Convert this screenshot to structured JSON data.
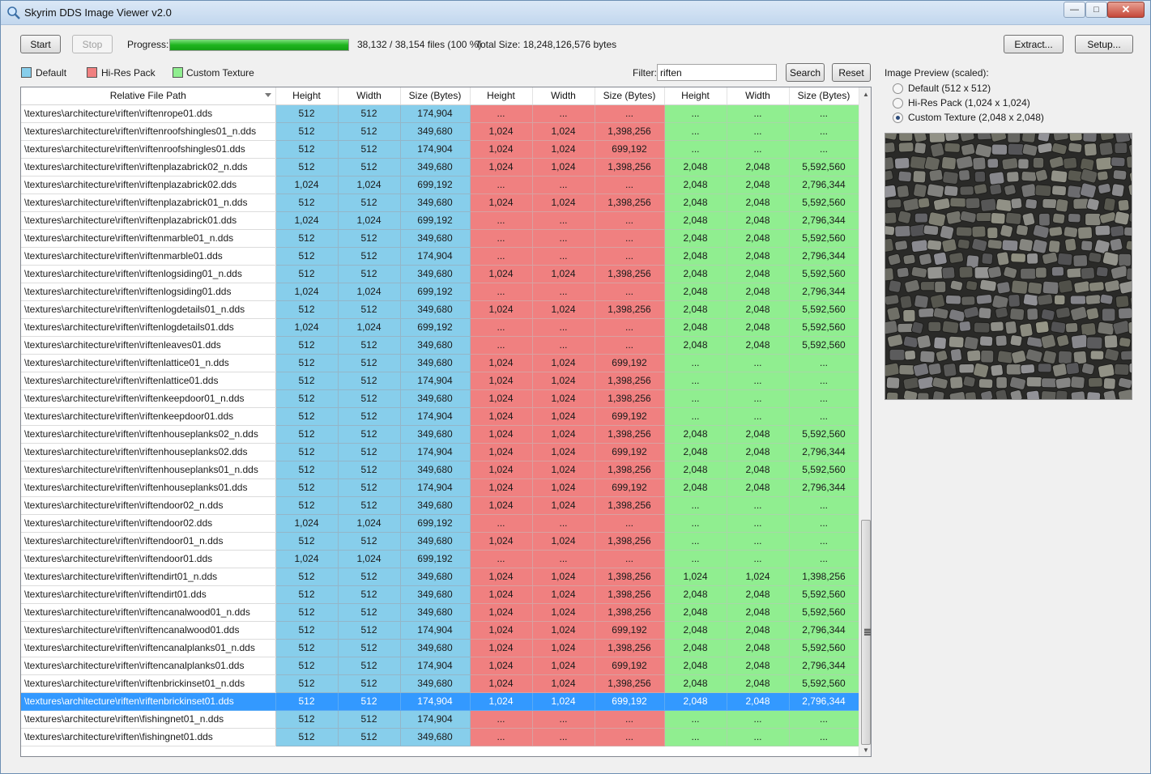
{
  "window": {
    "title": "Skyrim DDS Image Viewer v2.0",
    "min": "—",
    "max": "□",
    "close": "✕"
  },
  "toolbar": {
    "start": "Start",
    "stop": "Stop",
    "progress_label": "Progress:",
    "progress_fraction": 1.0,
    "files_text": "38,132 / 38,154 files (100 %)",
    "total_size": "Total Size: 18,248,126,576 bytes",
    "extract": "Extract...",
    "setup": "Setup..."
  },
  "legend": {
    "default": "Default",
    "hires": "Hi-Res Pack",
    "custom": "Custom Texture"
  },
  "colors": {
    "default": "#87ceeb",
    "hires": "#f08080",
    "custom": "#90ee90",
    "selected": "#3399ff"
  },
  "filter": {
    "label": "Filter:",
    "value": "riften",
    "search": "Search",
    "reset": "Reset"
  },
  "preview": {
    "label": "Image Preview (scaled):",
    "options": [
      "Default (512 x 512)",
      "Hi-Res Pack (1,024 x 1,024)",
      "Custom Texture (2,048 x 2,048)"
    ],
    "selected_index": 2
  },
  "grid": {
    "columns": [
      "Relative File Path",
      "Height",
      "Width",
      "Size (Bytes)",
      "Height",
      "Width",
      "Size (Bytes)",
      "Height",
      "Width",
      "Size (Bytes)"
    ],
    "selected_row": 33,
    "rows": [
      [
        "\\textures\\architecture\\riften\\riftenrope01.dds",
        "512",
        "512",
        "174,904",
        "...",
        "...",
        "...",
        "...",
        "...",
        "..."
      ],
      [
        "\\textures\\architecture\\riften\\riftenroofshingles01_n.dds",
        "512",
        "512",
        "349,680",
        "1,024",
        "1,024",
        "1,398,256",
        "...",
        "...",
        "..."
      ],
      [
        "\\textures\\architecture\\riften\\riftenroofshingles01.dds",
        "512",
        "512",
        "174,904",
        "1,024",
        "1,024",
        "699,192",
        "...",
        "...",
        "..."
      ],
      [
        "\\textures\\architecture\\riften\\riftenplazabrick02_n.dds",
        "512",
        "512",
        "349,680",
        "1,024",
        "1,024",
        "1,398,256",
        "2,048",
        "2,048",
        "5,592,560"
      ],
      [
        "\\textures\\architecture\\riften\\riftenplazabrick02.dds",
        "1,024",
        "1,024",
        "699,192",
        "...",
        "...",
        "...",
        "2,048",
        "2,048",
        "2,796,344"
      ],
      [
        "\\textures\\architecture\\riften\\riftenplazabrick01_n.dds",
        "512",
        "512",
        "349,680",
        "1,024",
        "1,024",
        "1,398,256",
        "2,048",
        "2,048",
        "5,592,560"
      ],
      [
        "\\textures\\architecture\\riften\\riftenplazabrick01.dds",
        "1,024",
        "1,024",
        "699,192",
        "...",
        "...",
        "...",
        "2,048",
        "2,048",
        "2,796,344"
      ],
      [
        "\\textures\\architecture\\riften\\riftenmarble01_n.dds",
        "512",
        "512",
        "349,680",
        "...",
        "...",
        "...",
        "2,048",
        "2,048",
        "5,592,560"
      ],
      [
        "\\textures\\architecture\\riften\\riftenmarble01.dds",
        "512",
        "512",
        "174,904",
        "...",
        "...",
        "...",
        "2,048",
        "2,048",
        "2,796,344"
      ],
      [
        "\\textures\\architecture\\riften\\riftenlogsiding01_n.dds",
        "512",
        "512",
        "349,680",
        "1,024",
        "1,024",
        "1,398,256",
        "2,048",
        "2,048",
        "5,592,560"
      ],
      [
        "\\textures\\architecture\\riften\\riftenlogsiding01.dds",
        "1,024",
        "1,024",
        "699,192",
        "...",
        "...",
        "...",
        "2,048",
        "2,048",
        "2,796,344"
      ],
      [
        "\\textures\\architecture\\riften\\riftenlogdetails01_n.dds",
        "512",
        "512",
        "349,680",
        "1,024",
        "1,024",
        "1,398,256",
        "2,048",
        "2,048",
        "5,592,560"
      ],
      [
        "\\textures\\architecture\\riften\\riftenlogdetails01.dds",
        "1,024",
        "1,024",
        "699,192",
        "...",
        "...",
        "...",
        "2,048",
        "2,048",
        "5,592,560"
      ],
      [
        "\\textures\\architecture\\riften\\riftenleaves01.dds",
        "512",
        "512",
        "349,680",
        "...",
        "...",
        "...",
        "2,048",
        "2,048",
        "5,592,560"
      ],
      [
        "\\textures\\architecture\\riften\\riftenlattice01_n.dds",
        "512",
        "512",
        "349,680",
        "1,024",
        "1,024",
        "699,192",
        "...",
        "...",
        "..."
      ],
      [
        "\\textures\\architecture\\riften\\riftenlattice01.dds",
        "512",
        "512",
        "174,904",
        "1,024",
        "1,024",
        "1,398,256",
        "...",
        "...",
        "..."
      ],
      [
        "\\textures\\architecture\\riften\\riftenkeepdoor01_n.dds",
        "512",
        "512",
        "349,680",
        "1,024",
        "1,024",
        "1,398,256",
        "...",
        "...",
        "..."
      ],
      [
        "\\textures\\architecture\\riften\\riftenkeepdoor01.dds",
        "512",
        "512",
        "174,904",
        "1,024",
        "1,024",
        "699,192",
        "...",
        "...",
        "..."
      ],
      [
        "\\textures\\architecture\\riften\\riftenhouseplanks02_n.dds",
        "512",
        "512",
        "349,680",
        "1,024",
        "1,024",
        "1,398,256",
        "2,048",
        "2,048",
        "5,592,560"
      ],
      [
        "\\textures\\architecture\\riften\\riftenhouseplanks02.dds",
        "512",
        "512",
        "174,904",
        "1,024",
        "1,024",
        "699,192",
        "2,048",
        "2,048",
        "2,796,344"
      ],
      [
        "\\textures\\architecture\\riften\\riftenhouseplanks01_n.dds",
        "512",
        "512",
        "349,680",
        "1,024",
        "1,024",
        "1,398,256",
        "2,048",
        "2,048",
        "5,592,560"
      ],
      [
        "\\textures\\architecture\\riften\\riftenhouseplanks01.dds",
        "512",
        "512",
        "174,904",
        "1,024",
        "1,024",
        "699,192",
        "2,048",
        "2,048",
        "2,796,344"
      ],
      [
        "\\textures\\architecture\\riften\\riftendoor02_n.dds",
        "512",
        "512",
        "349,680",
        "1,024",
        "1,024",
        "1,398,256",
        "...",
        "...",
        "..."
      ],
      [
        "\\textures\\architecture\\riften\\riftendoor02.dds",
        "1,024",
        "1,024",
        "699,192",
        "...",
        "...",
        "...",
        "...",
        "...",
        "..."
      ],
      [
        "\\textures\\architecture\\riften\\riftendoor01_n.dds",
        "512",
        "512",
        "349,680",
        "1,024",
        "1,024",
        "1,398,256",
        "...",
        "...",
        "..."
      ],
      [
        "\\textures\\architecture\\riften\\riftendoor01.dds",
        "1,024",
        "1,024",
        "699,192",
        "...",
        "...",
        "...",
        "...",
        "...",
        "..."
      ],
      [
        "\\textures\\architecture\\riften\\riftendirt01_n.dds",
        "512",
        "512",
        "349,680",
        "1,024",
        "1,024",
        "1,398,256",
        "1,024",
        "1,024",
        "1,398,256"
      ],
      [
        "\\textures\\architecture\\riften\\riftendirt01.dds",
        "512",
        "512",
        "349,680",
        "1,024",
        "1,024",
        "1,398,256",
        "2,048",
        "2,048",
        "5,592,560"
      ],
      [
        "\\textures\\architecture\\riften\\riftencanalwood01_n.dds",
        "512",
        "512",
        "349,680",
        "1,024",
        "1,024",
        "1,398,256",
        "2,048",
        "2,048",
        "5,592,560"
      ],
      [
        "\\textures\\architecture\\riften\\riftencanalwood01.dds",
        "512",
        "512",
        "174,904",
        "1,024",
        "1,024",
        "699,192",
        "2,048",
        "2,048",
        "2,796,344"
      ],
      [
        "\\textures\\architecture\\riften\\riftencanalplanks01_n.dds",
        "512",
        "512",
        "349,680",
        "1,024",
        "1,024",
        "1,398,256",
        "2,048",
        "2,048",
        "5,592,560"
      ],
      [
        "\\textures\\architecture\\riften\\riftencanalplanks01.dds",
        "512",
        "512",
        "174,904",
        "1,024",
        "1,024",
        "699,192",
        "2,048",
        "2,048",
        "2,796,344"
      ],
      [
        "\\textures\\architecture\\riften\\riftenbrickinset01_n.dds",
        "512",
        "512",
        "349,680",
        "1,024",
        "1,024",
        "1,398,256",
        "2,048",
        "2,048",
        "5,592,560"
      ],
      [
        "\\textures\\architecture\\riften\\riftenbrickinset01.dds",
        "512",
        "512",
        "174,904",
        "1,024",
        "1,024",
        "699,192",
        "2,048",
        "2,048",
        "2,796,344"
      ],
      [
        "\\textures\\architecture\\riften\\fishingnet01_n.dds",
        "512",
        "512",
        "174,904",
        "...",
        "...",
        "...",
        "...",
        "...",
        "..."
      ],
      [
        "\\textures\\architecture\\riften\\fishingnet01.dds",
        "512",
        "512",
        "349,680",
        "...",
        "...",
        "...",
        "...",
        "...",
        "..."
      ]
    ]
  },
  "icons": {
    "app": "magnifier-icon",
    "sort": "sort-down-icon"
  }
}
